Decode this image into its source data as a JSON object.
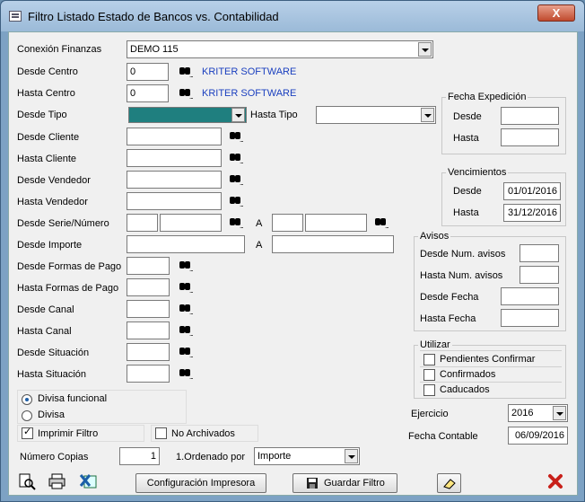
{
  "window": {
    "title": "Filtro Listado Estado de Bancos vs. Contabilidad",
    "close": "X"
  },
  "conexion": {
    "label": "Conexión Finanzas",
    "value": "DEMO 115"
  },
  "desde_centro": {
    "label": "Desde Centro",
    "value": "0",
    "name": "KRITER SOFTWARE"
  },
  "hasta_centro": {
    "label": "Hasta Centro",
    "value": "0",
    "name": "KRITER SOFTWARE"
  },
  "desde_tipo": {
    "label": "Desde Tipo",
    "value": ""
  },
  "hasta_tipo": {
    "label": "Hasta Tipo",
    "value": ""
  },
  "labels": {
    "desde_cliente": "Desde Cliente",
    "hasta_cliente": "Hasta Cliente",
    "desde_vendedor": "Desde Vendedor",
    "hasta_vendedor": "Hasta Vendedor",
    "desde_serie": "Desde Serie/Número",
    "desde_importe": "Desde Importe",
    "a": "A",
    "desde_formas": "Desde Formas de Pago",
    "hasta_formas": "Hasta Formas de Pago",
    "desde_canal": "Desde Canal",
    "hasta_canal": "Hasta Canal",
    "desde_situacion": "Desde Situación",
    "hasta_situacion": "Hasta Situación"
  },
  "fecha_expedicion": {
    "title": "Fecha Expedición",
    "desde": "Desde",
    "hasta": "Hasta",
    "desde_value": "",
    "hasta_value": ""
  },
  "vencimientos": {
    "title": "Vencimientos",
    "desde": "Desde",
    "hasta": "Hasta",
    "desde_value": "01/01/2016",
    "hasta_value": "31/12/2016"
  },
  "avisos": {
    "title": "Avisos",
    "desde_num": "Desde Num. avisos",
    "hasta_num": "Hasta Num. avisos",
    "desde_fecha": "Desde Fecha",
    "hasta_fecha": "Hasta Fecha"
  },
  "utilizar": {
    "title": "Utilizar",
    "items": [
      "Pendientes Confirmar",
      "Confirmados",
      "Caducados"
    ]
  },
  "divisa": {
    "funcional": "Divisa funcional",
    "divisa": "Divisa"
  },
  "imprimir_filtro": "Imprimir Filtro",
  "no_archivados": "No Archivados",
  "ejercicio": {
    "label": "Ejercicio",
    "value": "2016"
  },
  "fecha_contable": {
    "label": "Fecha Contable",
    "value": "06/09/2016"
  },
  "numero_copias": {
    "label": "Número Copias",
    "value": "1"
  },
  "ordenado": {
    "label": "1.Ordenado por",
    "value": "Importe"
  },
  "buttons": {
    "config": "Configuración Impresora",
    "guardar": "Guardar Filtro"
  }
}
